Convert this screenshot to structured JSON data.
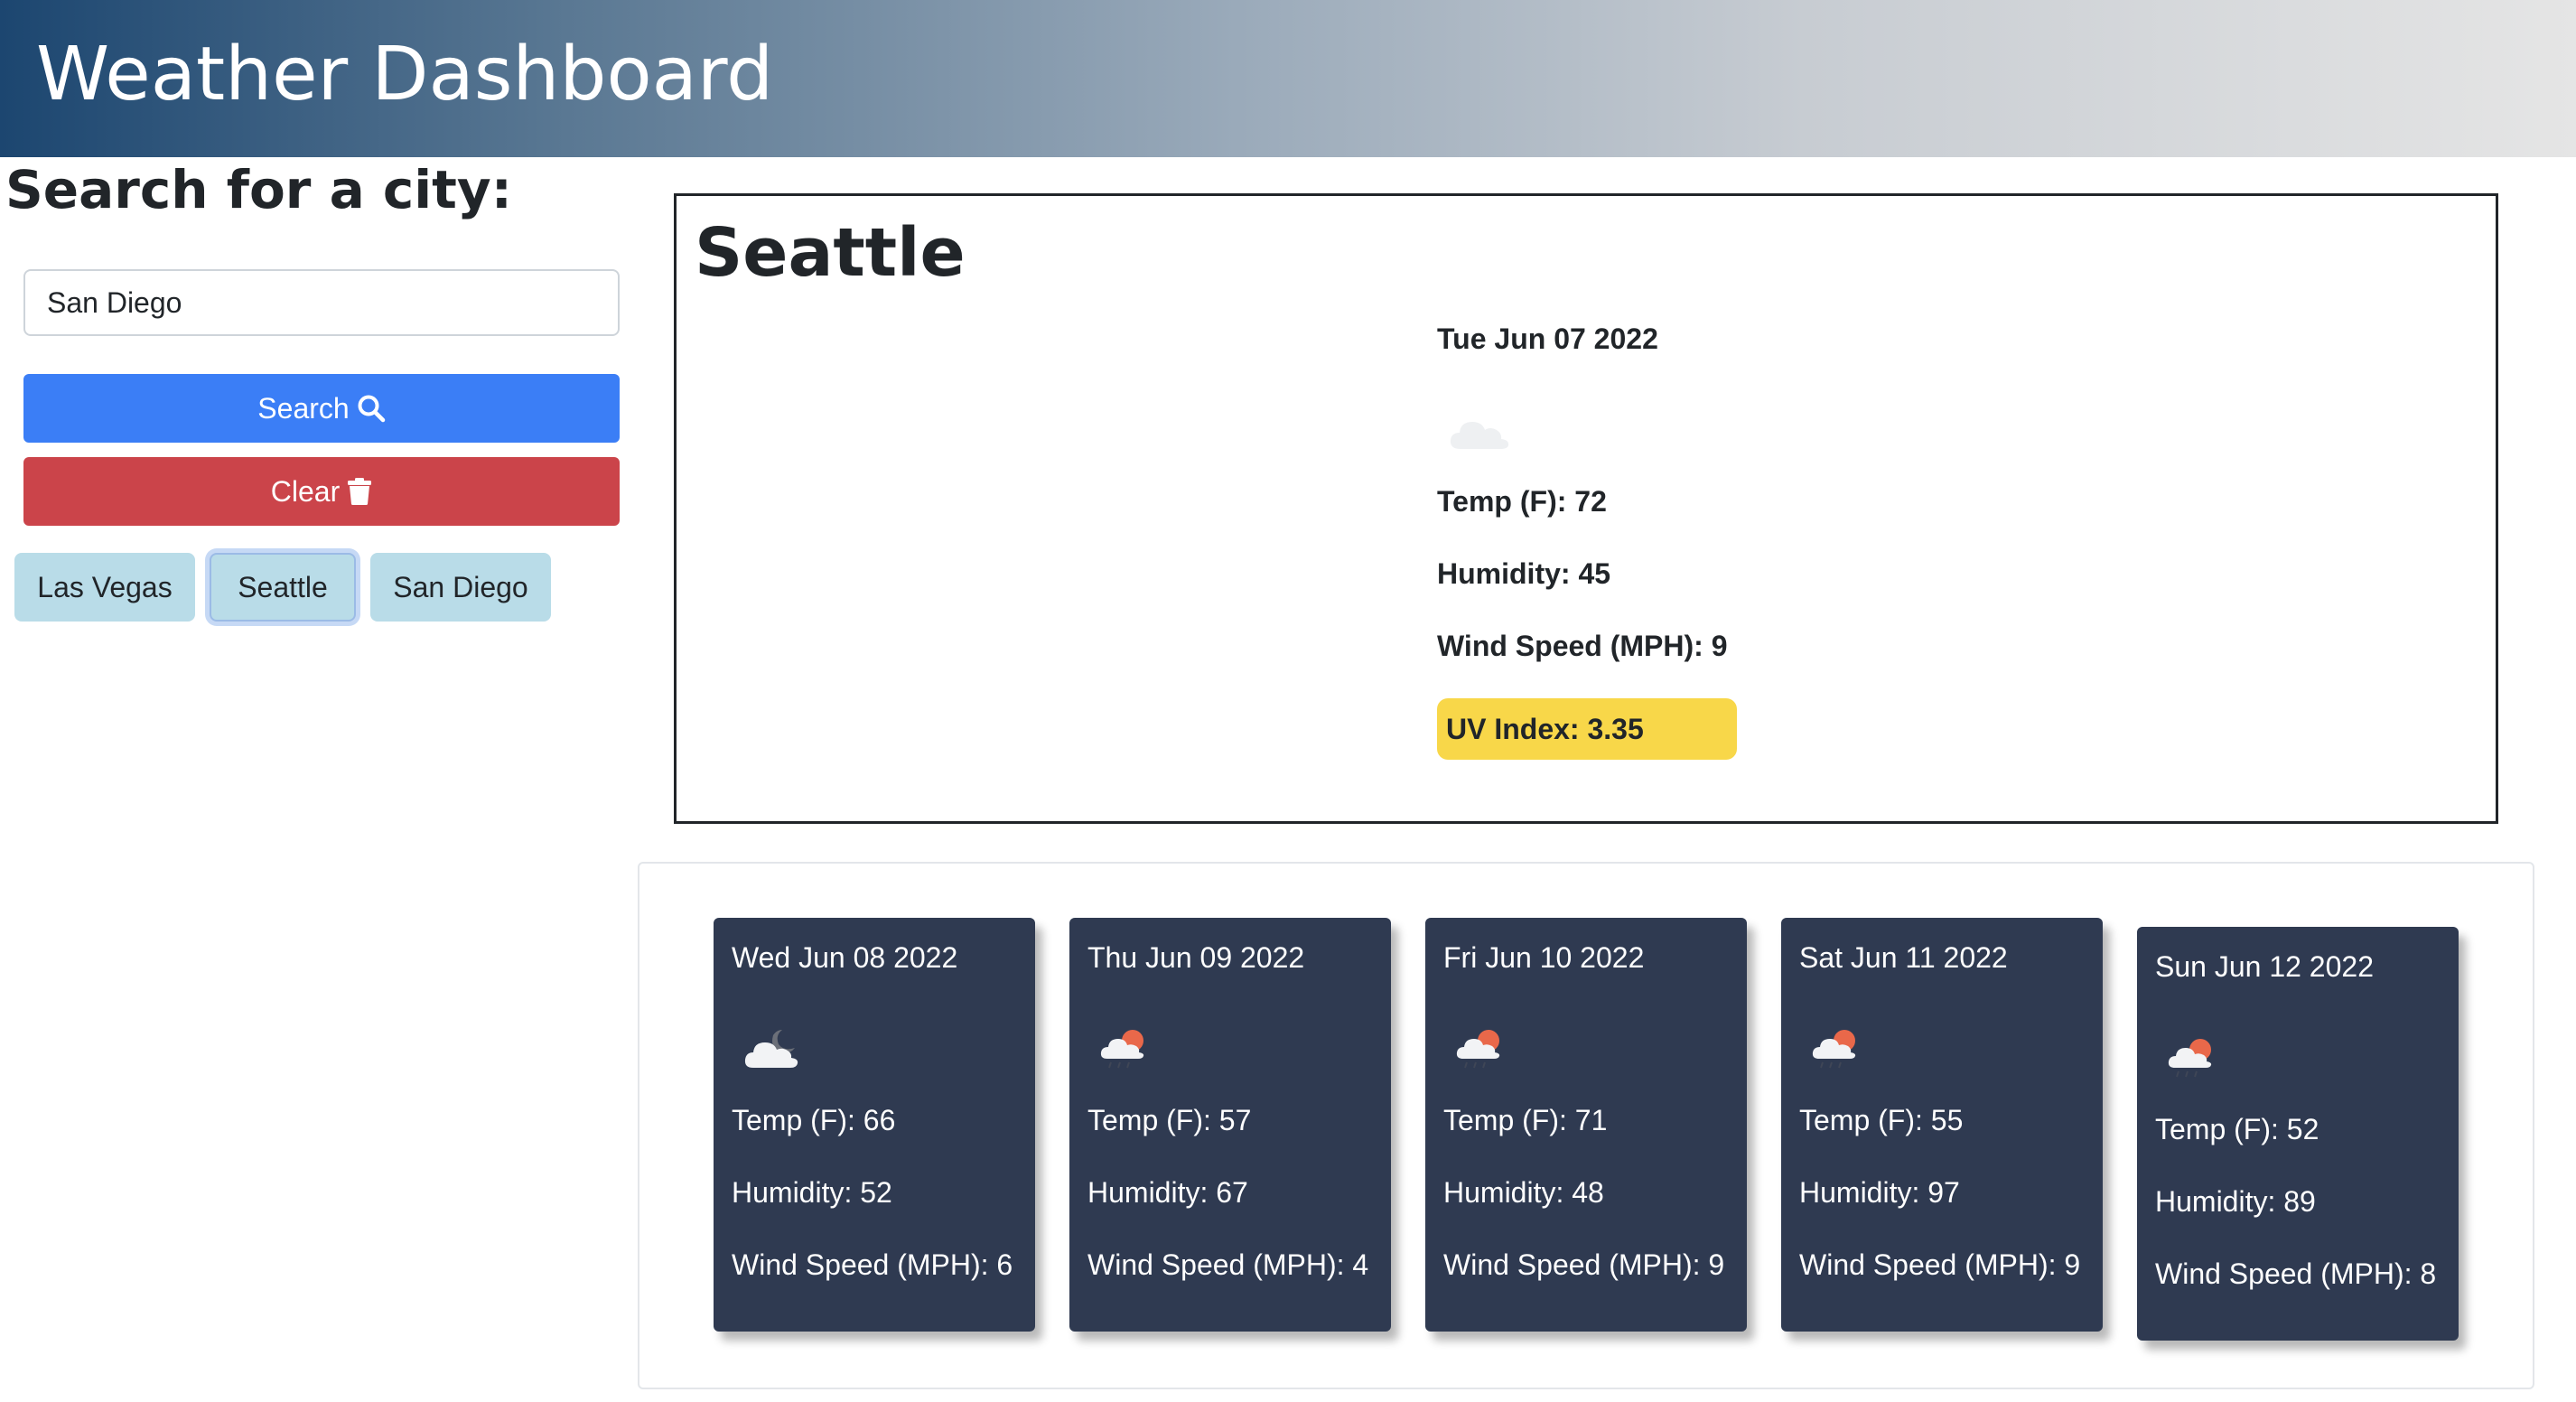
{
  "header": {
    "title": "Weather Dashboard"
  },
  "search": {
    "heading": "Search for a city:",
    "input_value": "San Diego",
    "search_label": "Search",
    "search_icon": "magnifier-icon",
    "clear_label": "Clear",
    "clear_icon": "trash-icon"
  },
  "history": [
    "Las Vegas",
    "Seattle",
    "San Diego"
  ],
  "current": {
    "city": "Seattle",
    "date": "Tue Jun 07 2022",
    "icon": "cloud-icon",
    "temp": "Temp (F): 72",
    "humidity": "Humidity: 45",
    "wind": "Wind Speed (MPH): 9",
    "uv": "UV Index: 3.35",
    "uv_color": "#f8d749"
  },
  "forecast": [
    {
      "date": "Wed Jun 08 2022",
      "icon": "cloud-moon-icon",
      "temp": "Temp (F): 66",
      "humidity": "Humidity: 52",
      "wind": "Wind Speed (MPH): 6"
    },
    {
      "date": "Thu Jun 09 2022",
      "icon": "rain-sun-icon",
      "temp": "Temp (F): 57",
      "humidity": "Humidity: 67",
      "wind": "Wind Speed (MPH): 4"
    },
    {
      "date": "Fri Jun 10 2022",
      "icon": "rain-sun-icon",
      "temp": "Temp (F): 71",
      "humidity": "Humidity: 48",
      "wind": "Wind Speed (MPH): 9"
    },
    {
      "date": "Sat Jun 11 2022",
      "icon": "rain-sun-icon",
      "temp": "Temp (F): 55",
      "humidity": "Humidity: 97",
      "wind": "Wind Speed (MPH): 9"
    },
    {
      "date": "Sun Jun 12 2022",
      "icon": "rain-sun-icon",
      "temp": "Temp (F): 52",
      "humidity": "Humidity: 89",
      "wind": "Wind Speed (MPH): 8"
    }
  ],
  "colors": {
    "search_button": "#3b7ef6",
    "clear_button": "#cb444a",
    "history_button": "#b9dce8",
    "forecast_card": "#2f3a51"
  }
}
